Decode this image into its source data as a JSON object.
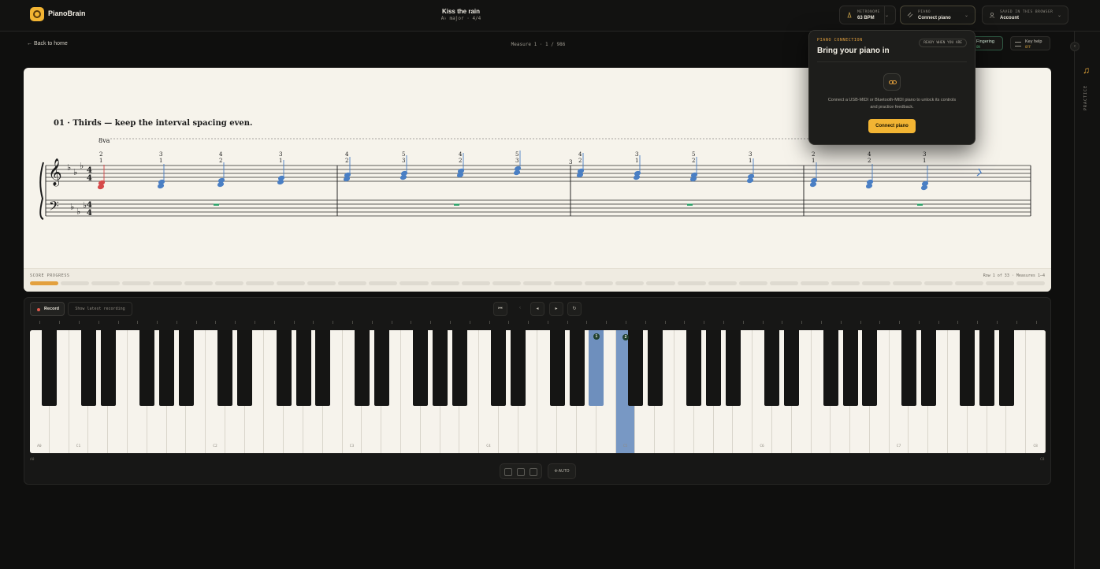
{
  "header": {
    "brand": "PianoBrain",
    "song_title": "Kiss the rain",
    "song_subtitle": "A♭ major · 4/4",
    "metronome": {
      "label": "METRONOME",
      "value": "63 BPM"
    },
    "piano": {
      "label": "PIANO",
      "value": "Connect piano"
    },
    "account": {
      "label": "SAVED IN THIS BROWSER",
      "value": "Account"
    }
  },
  "subbar": {
    "back_label": "← Back to home",
    "measure_text": "Measure 1 · 1 / 986",
    "fingering": {
      "label": "Fingering",
      "state": "ON"
    },
    "key_help": {
      "label": "Key help",
      "state": "OFF"
    }
  },
  "rail": {
    "label": "PRACTICE",
    "icon": "music-note-icon"
  },
  "score": {
    "exercise_title": "01 · Thirds — keep the interval spacing even.",
    "ottava": "8va",
    "progress_label": "SCORE PROGRESS",
    "progress_info": "Row 1 of 33 · Measures 1–4",
    "progress_segments": 33,
    "progress_active": 1,
    "fingerings": [
      {
        "top": "2",
        "bottom": "1"
      },
      {
        "top": "3",
        "bottom": "1"
      },
      {
        "top": "4",
        "bottom": "2"
      },
      {
        "top": "3",
        "bottom": "1"
      },
      {
        "top": "4",
        "bottom": "2"
      },
      {
        "top": "5",
        "bottom": "3"
      },
      {
        "top": "4",
        "bottom": "2"
      },
      {
        "top": "5",
        "bottom": "3"
      },
      {
        "top": "4",
        "bottom": "2"
      },
      {
        "top": "3",
        "bottom": "1"
      },
      {
        "top": "5",
        "bottom": "2"
      },
      {
        "top": "3",
        "bottom": "1"
      },
      {
        "top": "2",
        "bottom": "1"
      },
      {
        "top": "4",
        "bottom": "2"
      },
      {
        "top": "3",
        "bottom": "1"
      }
    ],
    "extra_finger": "3",
    "colors": {
      "current": "#d64a4a",
      "upcoming": "#4a7fc4",
      "rest": "#2fa36b"
    }
  },
  "popover": {
    "eyebrow": "PIANO CONNECTION",
    "title": "Bring your piano in",
    "badge": "READY WHEN YOU ARE",
    "description": "Connect a USB-MIDI or Bluetooth-MIDI piano to unlock its controls and practice feedback.",
    "button": "Connect piano"
  },
  "keyboard": {
    "record_label": "Record",
    "latest_label": "Show latest recording",
    "auto_label": "AUTO",
    "octave_labels": [
      "A0",
      "C1",
      "C2",
      "C3",
      "C4",
      "C5",
      "C6",
      "C7",
      "C8"
    ],
    "end_labels": {
      "left": "A0",
      "right": "C8"
    },
    "highlight_black_finger": "1",
    "highlight_white_finger": "2",
    "highlight_color": "#7898c4"
  }
}
